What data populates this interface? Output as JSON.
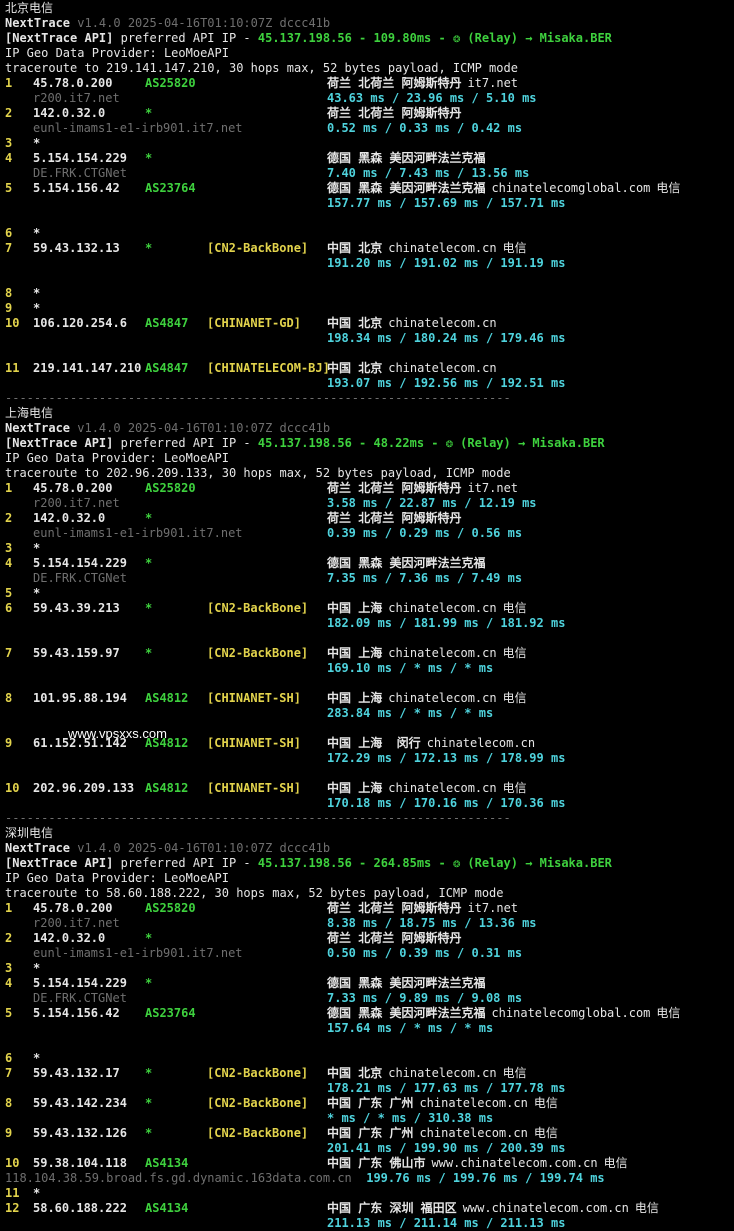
{
  "colors": {
    "background": "#000000",
    "text": "#d6d6d6",
    "dim": "#6f6f6f",
    "as_green": "#3ed13e",
    "tag_yellow": "#e2d34c",
    "latency_cyan": "#4fd3dd"
  },
  "watermark": "www.vpsxxs.com",
  "separator": "----------------------------------------------------------------------",
  "sections": [
    {
      "title": "北京电信",
      "app": "NextTrace",
      "version": "v1.4.0 2025-04-16T01:10:07Z dccc41b",
      "api_label": "[NextTrace API]",
      "api_text": " preferred API IP - ",
      "api_ip": "45.137.198.56",
      "api_ms": " - 109.80ms - ",
      "relay": "❂ (Relay) → Misaka.BER",
      "geo_provider": "IP Geo Data Provider: LeoMoeAPI",
      "trace_line": "traceroute to 219.141.147.210, 30 hops max, 52 bytes payload, ICMP mode",
      "hops": [
        {
          "n": "1",
          "ip": "45.78.0.200",
          "as": "AS25820",
          "tag": "",
          "geo": "荷兰 北荷兰 阿姆斯特丹",
          "domain": "it7.net",
          "carrier": "",
          "rdns": "r200.it7.net",
          "lat": "43.63 ms / 23.96 ms / 5.10 ms"
        },
        {
          "n": "2",
          "ip": "142.0.32.0",
          "as": "*",
          "tag": "",
          "geo": "荷兰 北荷兰 阿姆斯特丹",
          "domain": "",
          "carrier": "",
          "rdns": "eunl-imams1-e1-irb901.it7.net",
          "lat": "0.52 ms / 0.33 ms / 0.42 ms"
        },
        {
          "n": "3",
          "ip": "*",
          "star": true
        },
        {
          "n": "4",
          "ip": "5.154.154.229",
          "as": "*",
          "tag": "",
          "geo": "德国 黑森 美因河畔法兰克福",
          "domain": "",
          "carrier": "",
          "rdns": "DE.FRK.CTGNet",
          "lat": "7.40 ms / 7.43 ms / 13.56 ms"
        },
        {
          "n": "5",
          "ip": "5.154.156.42",
          "as": "AS23764",
          "tag": "",
          "geo": "德国 黑森 美因河畔法兰克福",
          "domain": "chinatelecomglobal.com",
          "carrier": "电信",
          "rdns": "",
          "lat": "157.77 ms / 157.69 ms / 157.71 ms",
          "blank_after": true
        },
        {
          "n": "6",
          "ip": "*",
          "star": true
        },
        {
          "n": "7",
          "ip": "59.43.132.13",
          "as": "*",
          "tag": "[CN2-BackBone]",
          "geo": "中国 北京",
          "domain": "chinatelecom.cn",
          "carrier": "电信",
          "rdns": "",
          "lat": "191.20 ms / 191.02 ms / 191.19 ms",
          "blank_after": true
        },
        {
          "n": "8",
          "ip": "*",
          "star": true
        },
        {
          "n": "9",
          "ip": "*",
          "star": true
        },
        {
          "n": "10",
          "ip": "106.120.254.6",
          "as": "AS4847",
          "tag": "[CHINANET-GD]",
          "geo": "中国 北京",
          "domain": "chinatelecom.cn",
          "carrier": "",
          "rdns": "",
          "lat": "198.34 ms / 180.24 ms / 179.46 ms",
          "blank_after": true
        },
        {
          "n": "11",
          "ip": "219.141.147.210",
          "as": "AS4847",
          "tag": "[CHINATELECOM-BJ]",
          "geo": "中国 北京",
          "domain": "chinatelecom.cn",
          "carrier": "",
          "rdns": "",
          "lat": "193.07 ms / 192.56 ms / 192.51 ms"
        }
      ]
    },
    {
      "title": "上海电信",
      "app": "NextTrace",
      "version": "v1.4.0 2025-04-16T01:10:07Z dccc41b",
      "api_label": "[NextTrace API]",
      "api_text": " preferred API IP - ",
      "api_ip": "45.137.198.56",
      "api_ms": " - 48.22ms - ",
      "relay": "❂ (Relay) → Misaka.BER",
      "geo_provider": "IP Geo Data Provider: LeoMoeAPI",
      "trace_line": "traceroute to 202.96.209.133, 30 hops max, 52 bytes payload, ICMP mode",
      "hops": [
        {
          "n": "1",
          "ip": "45.78.0.200",
          "as": "AS25820",
          "tag": "",
          "geo": "荷兰 北荷兰 阿姆斯特丹",
          "domain": "it7.net",
          "carrier": "",
          "rdns": "r200.it7.net",
          "lat": "3.58 ms / 22.87 ms / 12.19 ms"
        },
        {
          "n": "2",
          "ip": "142.0.32.0",
          "as": "*",
          "tag": "",
          "geo": "荷兰 北荷兰 阿姆斯特丹",
          "domain": "",
          "carrier": "",
          "rdns": "eunl-imams1-e1-irb901.it7.net",
          "lat": "0.39 ms / 0.29 ms / 0.56 ms"
        },
        {
          "n": "3",
          "ip": "*",
          "star": true
        },
        {
          "n": "4",
          "ip": "5.154.154.229",
          "as": "*",
          "tag": "",
          "geo": "德国 黑森 美因河畔法兰克福",
          "domain": "",
          "carrier": "",
          "rdns": "DE.FRK.CTGNet",
          "lat": "7.35 ms / 7.36 ms / 7.49 ms"
        },
        {
          "n": "5",
          "ip": "*",
          "star": true
        },
        {
          "n": "6",
          "ip": "59.43.39.213",
          "as": "*",
          "tag": "[CN2-BackBone]",
          "geo": "中国 上海",
          "domain": "chinatelecom.cn",
          "carrier": "电信",
          "rdns": "",
          "lat": "182.09 ms / 181.99 ms / 181.92 ms",
          "blank_after": true
        },
        {
          "n": "7",
          "ip": "59.43.159.97",
          "as": "*",
          "tag": "[CN2-BackBone]",
          "geo": "中国 上海",
          "domain": "chinatelecom.cn",
          "carrier": "电信",
          "rdns": "",
          "lat": "169.10 ms / * ms / * ms",
          "blank_after": true
        },
        {
          "n": "8",
          "ip": "101.95.88.194",
          "as": "AS4812",
          "tag": "[CHINANET-SH]",
          "geo": "中国 上海",
          "domain": "chinatelecom.cn",
          "carrier": "电信",
          "rdns": "",
          "lat": "283.84 ms / * ms / * ms",
          "blank_after": true
        },
        {
          "n": "9",
          "ip": "61.152.51.142",
          "as": "AS4812",
          "tag": "[CHINANET-SH]",
          "geo": "中国 上海  闵行",
          "domain": "chinatelecom.cn",
          "carrier": "",
          "rdns": "",
          "lat": "172.29 ms / 172.13 ms / 178.99 ms",
          "blank_after": true
        },
        {
          "n": "10",
          "ip": "202.96.209.133",
          "as": "AS4812",
          "tag": "[CHINANET-SH]",
          "geo": "中国 上海",
          "domain": "chinatelecom.cn",
          "carrier": "电信",
          "rdns": "",
          "lat": "170.18 ms / 170.16 ms / 170.36 ms"
        }
      ]
    },
    {
      "title": "深圳电信",
      "app": "NextTrace",
      "version": "v1.4.0 2025-04-16T01:10:07Z dccc41b",
      "api_label": "[NextTrace API]",
      "api_text": " preferred API IP - ",
      "api_ip": "45.137.198.56",
      "api_ms": " - 264.85ms - ",
      "relay": "❂ (Relay) → Misaka.BER",
      "geo_provider": "IP Geo Data Provider: LeoMoeAPI",
      "trace_line": "traceroute to 58.60.188.222, 30 hops max, 52 bytes payload, ICMP mode",
      "hops": [
        {
          "n": "1",
          "ip": "45.78.0.200",
          "as": "AS25820",
          "tag": "",
          "geo": "荷兰 北荷兰 阿姆斯特丹",
          "domain": "it7.net",
          "carrier": "",
          "rdns": "r200.it7.net",
          "lat": "8.38 ms / 18.75 ms / 13.36 ms"
        },
        {
          "n": "2",
          "ip": "142.0.32.0",
          "as": "*",
          "tag": "",
          "geo": "荷兰 北荷兰 阿姆斯特丹",
          "domain": "",
          "carrier": "",
          "rdns": "eunl-imams1-e1-irb901.it7.net",
          "lat": "0.50 ms / 0.39 ms / 0.31 ms"
        },
        {
          "n": "3",
          "ip": "*",
          "star": true
        },
        {
          "n": "4",
          "ip": "5.154.154.229",
          "as": "*",
          "tag": "",
          "geo": "德国 黑森 美因河畔法兰克福",
          "domain": "",
          "carrier": "",
          "rdns": "DE.FRK.CTGNet",
          "lat": "7.33 ms / 9.89 ms / 9.08 ms"
        },
        {
          "n": "5",
          "ip": "5.154.156.42",
          "as": "AS23764",
          "tag": "",
          "geo": "德国 黑森 美因河畔法兰克福",
          "domain": "chinatelecomglobal.com",
          "carrier": "电信",
          "rdns": "",
          "lat": "157.64 ms / * ms / * ms",
          "blank_after": true
        },
        {
          "n": "6",
          "ip": "*",
          "star": true
        },
        {
          "n": "7",
          "ip": "59.43.132.17",
          "as": "*",
          "tag": "[CN2-BackBone]",
          "geo": "中国 北京",
          "domain": "chinatelecom.cn",
          "carrier": "电信",
          "rdns": "",
          "lat": "178.21 ms / 177.63 ms / 177.78 ms"
        },
        {
          "n": "8",
          "ip": "59.43.142.234",
          "as": "*",
          "tag": "[CN2-BackBone]",
          "geo": "中国 广东 广州",
          "domain": "chinatelecom.cn",
          "carrier": "电信",
          "rdns": "",
          "lat": "* ms / * ms / 310.38 ms"
        },
        {
          "n": "9",
          "ip": "59.43.132.126",
          "as": "*",
          "tag": "[CN2-BackBone]",
          "geo": "中国 广东 广州",
          "domain": "chinatelecom.cn",
          "carrier": "电信",
          "rdns": "",
          "lat": "201.41 ms / 199.90 ms / 200.39 ms"
        },
        {
          "n": "10",
          "ip": "59.38.104.118",
          "as": "AS4134",
          "tag": "",
          "geo": "中国 广东 佛山市",
          "domain": "www.chinatelecom.com.cn",
          "carrier": "电信",
          "rdns": "118.104.38.59.broad.fs.gd.dynamic.163data.com.cn",
          "lat": "199.76 ms / 199.76 ms / 199.74 ms",
          "rdns_inline": true
        },
        {
          "n": "11",
          "ip": "*",
          "star": true
        },
        {
          "n": "12",
          "ip": "58.60.188.222",
          "as": "AS4134",
          "tag": "",
          "geo": "中国 广东 深圳 福田区",
          "domain": "www.chinatelecom.com.cn",
          "carrier": "电信",
          "rdns": "",
          "lat": "211.13 ms / 211.14 ms / 211.13 ms"
        }
      ]
    }
  ]
}
